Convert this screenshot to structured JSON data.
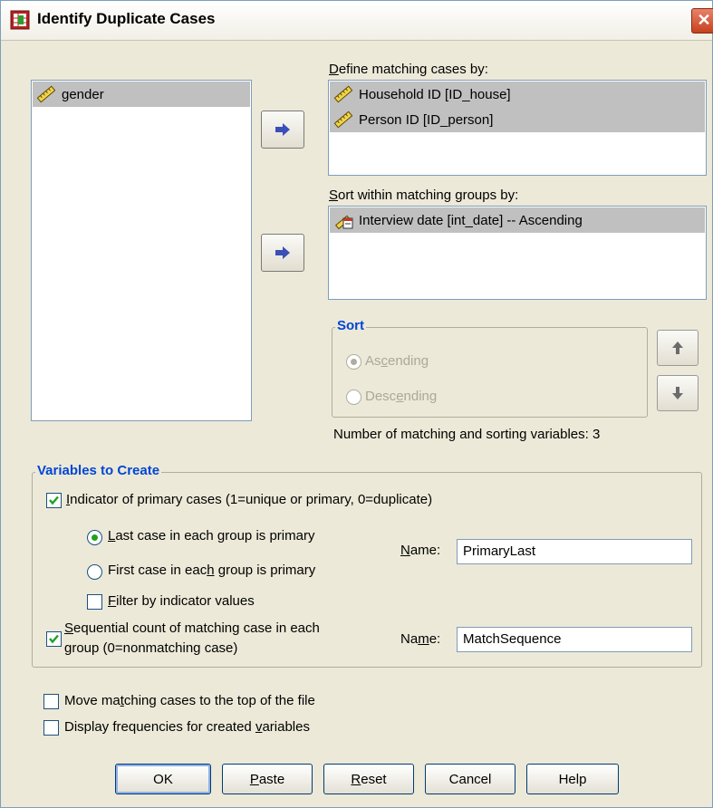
{
  "window": {
    "title": "Identify Duplicate Cases",
    "close": "✕"
  },
  "source_list": {
    "items": [
      {
        "label": "gender",
        "icon": "ruler-scale-icon"
      }
    ]
  },
  "define_matching": {
    "label_pre": "",
    "label_u": "D",
    "label_post": "efine matching cases by:",
    "items": [
      {
        "label": "Household ID [ID_house]",
        "icon": "ruler-scale-icon"
      },
      {
        "label": "Person ID [ID_person]",
        "icon": "ruler-scale-icon"
      }
    ]
  },
  "sort_within": {
    "label_pre": "",
    "label_u": "S",
    "label_post": "ort within matching groups by:",
    "items": [
      {
        "label": "Interview date [int_date] -- Ascending",
        "icon": "date-variable-icon"
      }
    ]
  },
  "sort_group": {
    "legend": "Sort",
    "ascending": {
      "pre": "As",
      "u": "c",
      "post": "ending",
      "selected": true
    },
    "descending": {
      "pre": "Desc",
      "u": "e",
      "post": "nding",
      "selected": false
    },
    "enabled": false
  },
  "count_text": "Number of matching and sorting variables:  3",
  "variables_group": {
    "legend": "Variables to Create",
    "indicator": {
      "pre": "",
      "u": "I",
      "post": "ndicator of primary cases (1=unique or primary, 0=duplicate)",
      "checked": true
    },
    "last_case": {
      "pre": "",
      "u": "L",
      "post": "ast case in each group is primary",
      "selected": true
    },
    "first_case": {
      "pre": "First case in eac",
      "u": "h",
      "post": " group is primary",
      "selected": false
    },
    "filter": {
      "pre": "",
      "u": "F",
      "post": "ilter by indicator values",
      "checked": false
    },
    "name1": {
      "pre": "",
      "u": "N",
      "post": "ame:",
      "value": "PrimaryLast"
    },
    "sequential": {
      "line1_pre": "",
      "line1_u": "S",
      "line1_post": "equential count of matching case in each",
      "line2": "group (0=nonmatching case)",
      "checked": true
    },
    "name2": {
      "pre": "Na",
      "u": "m",
      "post": "e:",
      "value": "MatchSequence"
    }
  },
  "move_matching": {
    "pre": "Move ma",
    "u": "t",
    "post": "ching cases to the top of the file",
    "checked": false
  },
  "display_freq": {
    "pre": "Display frequencies for created ",
    "u": "v",
    "post": "ariables",
    "checked": false
  },
  "buttons": {
    "ok": "OK",
    "paste": {
      "pre": "",
      "u": "P",
      "post": "aste"
    },
    "reset": {
      "pre": "",
      "u": "R",
      "post": "eset"
    },
    "cancel": "Cancel",
    "help": "Help"
  },
  "colors": {
    "legend": "#0046D5",
    "selection": "#C0C0C0",
    "dialog_bg": "#ECE9D8"
  }
}
